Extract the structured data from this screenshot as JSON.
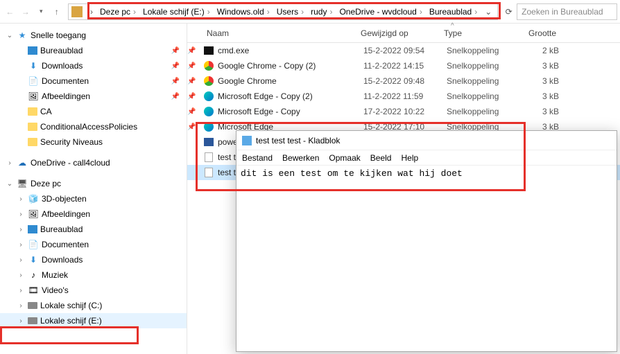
{
  "toolbar": {
    "search_placeholder": "Zoeken in Bureaublad"
  },
  "breadcrumb": [
    {
      "label": "Deze pc"
    },
    {
      "label": "Lokale schijf (E:)"
    },
    {
      "label": "Windows.old"
    },
    {
      "label": "Users"
    },
    {
      "label": "rudy"
    },
    {
      "label": "OneDrive - wvdcloud"
    },
    {
      "label": "Bureaublad"
    }
  ],
  "sidebar": {
    "quick_access": "Snelle toegang",
    "qa_items": [
      {
        "label": "Bureaublad"
      },
      {
        "label": "Downloads"
      },
      {
        "label": "Documenten"
      },
      {
        "label": "Afbeeldingen"
      },
      {
        "label": "CA"
      },
      {
        "label": "ConditionalAccessPolicies"
      },
      {
        "label": "Security Niveaus"
      }
    ],
    "onedrive": "OneDrive - call4cloud",
    "this_pc": "Deze pc",
    "pc_items": [
      {
        "label": "3D-objecten"
      },
      {
        "label": "Afbeeldingen"
      },
      {
        "label": "Bureaublad"
      },
      {
        "label": "Documenten"
      },
      {
        "label": "Downloads"
      },
      {
        "label": "Muziek"
      },
      {
        "label": "Video's"
      },
      {
        "label": "Lokale schijf (C:)"
      },
      {
        "label": "Lokale schijf (E:)"
      }
    ]
  },
  "columns": {
    "name": "Naam",
    "date": "Gewijzigd op",
    "type": "Type",
    "size": "Grootte"
  },
  "files": [
    {
      "name": "cmd.exe",
      "date": "15-2-2022 09:54",
      "type": "Snelkoppeling",
      "size": "2 kB",
      "icon": "cmd"
    },
    {
      "name": "Google Chrome - Copy (2)",
      "date": "11-2-2022 14:15",
      "type": "Snelkoppeling",
      "size": "3 kB",
      "icon": "chrome"
    },
    {
      "name": "Google Chrome",
      "date": "15-2-2022 09:48",
      "type": "Snelkoppeling",
      "size": "3 kB",
      "icon": "chrome"
    },
    {
      "name": "Microsoft Edge - Copy (2)",
      "date": "11-2-2022 11:59",
      "type": "Snelkoppeling",
      "size": "3 kB",
      "icon": "edge"
    },
    {
      "name": "Microsoft Edge - Copy",
      "date": "17-2-2022 10:22",
      "type": "Snelkoppeling",
      "size": "3 kB",
      "icon": "edge"
    },
    {
      "name": "Microsoft Edge",
      "date": "15-2-2022 17:10",
      "type": "Snelkoppeling",
      "size": "3 kB",
      "icon": "edge"
    },
    {
      "name": "power",
      "date": "",
      "type": "",
      "size": "",
      "icon": "ps"
    },
    {
      "name": "test te",
      "date": "",
      "type": "",
      "size": "",
      "icon": "txt"
    },
    {
      "name": "test te",
      "date": "",
      "type": "",
      "size": "",
      "icon": "txt",
      "selected": true
    }
  ],
  "notepad": {
    "title": "test test test - Kladblok",
    "menus": [
      "Bestand",
      "Bewerken",
      "Opmaak",
      "Beeld",
      "Help"
    ],
    "content": "dit is een test om te kijken wat hij doet"
  }
}
